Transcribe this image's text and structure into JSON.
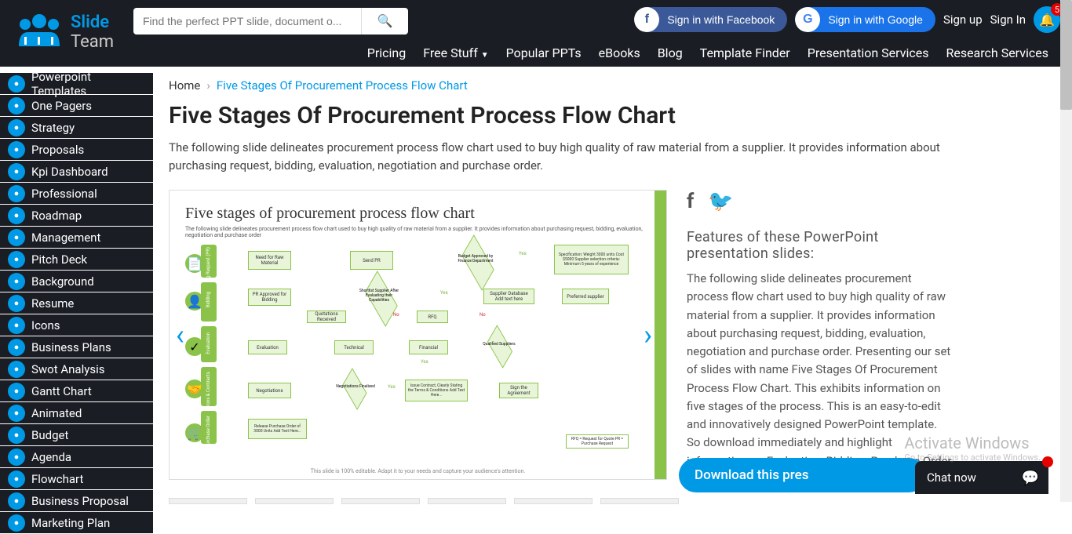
{
  "header": {
    "logo_slide": "Slide",
    "logo_team": "Team",
    "search_placeholder": "Find the perfect PPT slide, document o...",
    "fb_label": "Sign in with Facebook",
    "google_label": "Sign in with Google",
    "signup": "Sign up",
    "signin": "Sign In",
    "bell_count": "5"
  },
  "topnav": [
    "Pricing",
    "Free Stuff",
    "Popular PPTs",
    "eBooks",
    "Blog",
    "Template Finder",
    "Presentation Services",
    "Research Services"
  ],
  "sidebar": [
    "Powerpoint Templates",
    "One Pagers",
    "Strategy",
    "Proposals",
    "Kpi Dashboard",
    "Professional",
    "Roadmap",
    "Management",
    "Pitch Deck",
    "Background",
    "Resume",
    "Icons",
    "Business Plans",
    "Swot Analysis",
    "Gantt Chart",
    "Animated",
    "Budget",
    "Agenda",
    "Flowchart",
    "Business Proposal",
    "Marketing Plan"
  ],
  "breadcrumb": {
    "home": "Home",
    "current": "Five Stages Of Procurement Process Flow Chart"
  },
  "page": {
    "title": "Five Stages Of Procurement Process Flow Chart",
    "description": "The following slide delineates procurement process flow chart used to buy high quality of raw material from a supplier. It provides information about purchasing request, bidding, evaluation, negotiation and purchase order."
  },
  "slide": {
    "title": "Five stages of procurement process flow chart",
    "subtitle": "The following slide delineates procurement process flow chart used to buy high quality of raw material from a supplier. It provides information about purchasing request, bidding, evaluation, negotiation and purchase order",
    "stages": [
      "Purchasing Request (PR)",
      "Bidding",
      "Evaluation",
      "Negotiations & Contracts",
      "Purchase Order"
    ],
    "boxes": {
      "need_raw": "Need for Raw Material",
      "send_pr": "Send PR",
      "budget_approved": "Budget Approved by Finance Department",
      "spec": "Specification: Weight 3000 units Cost $5000 Supplier selection criteria: Minimum 5 years of experience",
      "pr_approved": "PR Approved for Bidding",
      "shortlist": "Shortlist Supplier After Evaluating their Capabilities",
      "supplier_db": "Supplier Database Add text here",
      "preferred": "Preferred supplier",
      "quotations": "Quotations Received",
      "rfq": "RFQ",
      "evaluation": "Evaluation",
      "technical": "Technical",
      "financial": "Financial",
      "qualified": "Qualified Suppliers",
      "negotiations": "Negotiations",
      "neg_finalized": "Negotiations Finalized",
      "issue_contract": "Issue Contract, Clearly Stating the Terms & Conditions Add Text Here...",
      "sign": "Sign the Agreement",
      "release_po": "Release Purchase Order of 3000 Units Add Text Here...",
      "yes": "Yes",
      "no": "No",
      "legend": "RFQ = Request for Quote  PR = Purchase Request"
    },
    "footer": "This slide is 100% editable. Adapt it to your needs and capture your audience's attention."
  },
  "features": {
    "title": "Features of these PowerPoint presentation slides:",
    "text": "The following slide delineates procurement process flow chart used to buy high quality of raw material from a supplier. It provides information about purchasing request, bidding, evaluation, negotiation and purchase order. Presenting our set of slides with name Five Stages Of Procurement Process Flow Chart. This exhibits information on five stages of the process. This is an easy-to-edit and innovatively designed PowerPoint template. So download immediately and highlight information on Evaluation, Bidding, Purchase Order, Purchasing Request."
  },
  "download_label": "Download this pres",
  "chat_label": "Chat now",
  "watermark": {
    "title": "Activate Windows",
    "sub": "Go to Settings to activate Windows."
  }
}
